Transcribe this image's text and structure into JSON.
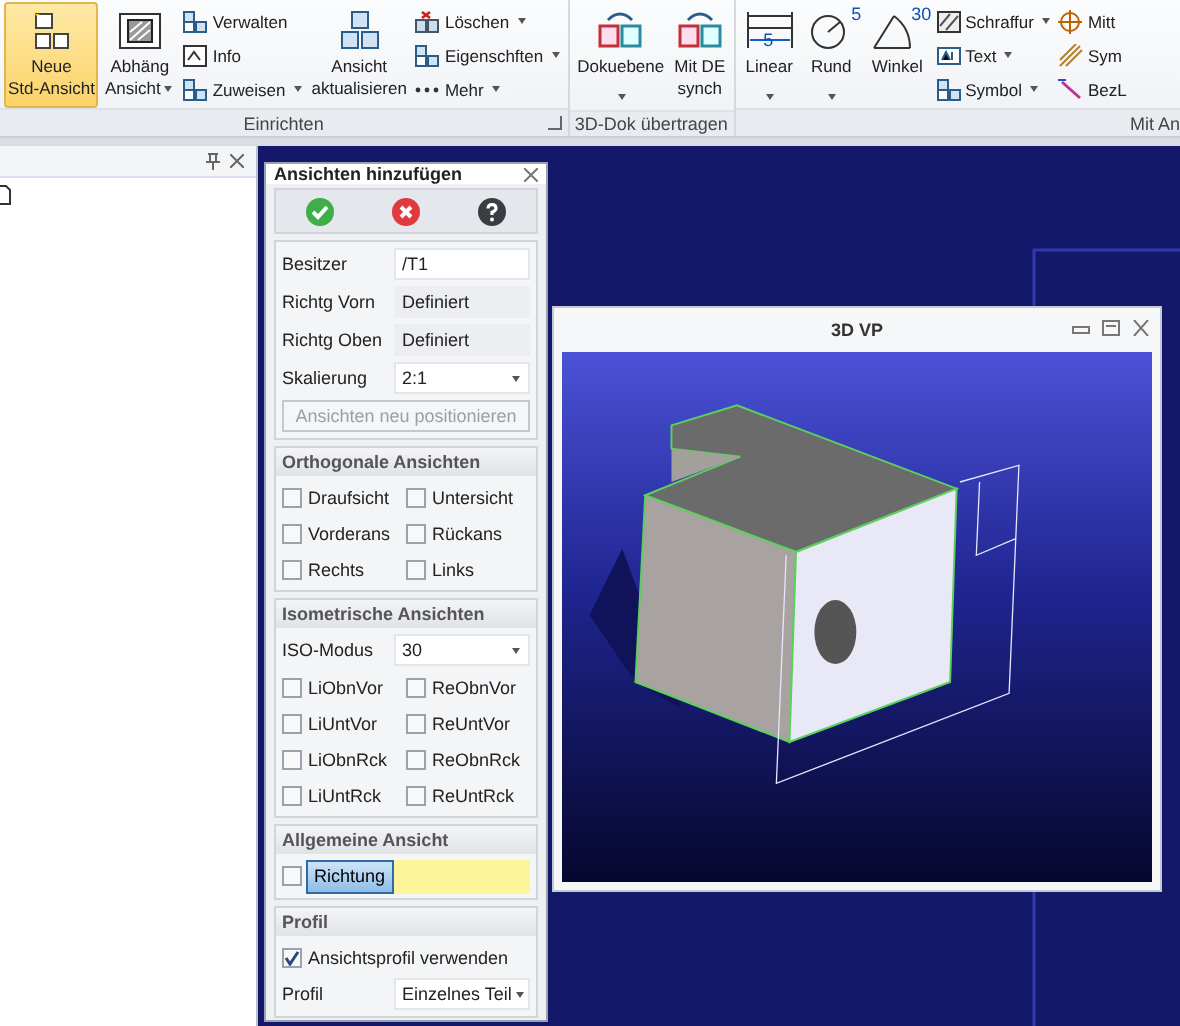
{
  "ribbon": {
    "groups": [
      {
        "label": "Einrichten",
        "launcher": true,
        "items": [
          {
            "kind": "large",
            "lines": [
              "Neue",
              "Std-Ansicht"
            ],
            "selected": true,
            "dropdown": false
          },
          {
            "kind": "large",
            "lines": [
              "Abhäng",
              "Ansicht"
            ],
            "selected": false,
            "dropdown": true
          },
          {
            "kind": "stack",
            "items": [
              {
                "label": "Verwalten",
                "dropdown": false
              },
              {
                "label": "Info",
                "dropdown": false
              },
              {
                "label": "Zuweisen",
                "dropdown": true
              }
            ]
          },
          {
            "kind": "large",
            "lines": [
              "Ansicht",
              "aktualisieren"
            ],
            "selected": false,
            "dropdown": false
          },
          {
            "kind": "stack",
            "items": [
              {
                "label": "Löschen",
                "dropdown": true
              },
              {
                "label": "Eigenschften",
                "dropdown": true
              },
              {
                "label": "Mehr",
                "dropdown": true
              }
            ]
          }
        ]
      },
      {
        "label": "3D-Dok übertragen",
        "launcher": false,
        "items": [
          {
            "kind": "large",
            "lines": [
              "Dokuebene"
            ],
            "selected": false,
            "dropdown": true
          },
          {
            "kind": "large",
            "lines": [
              "Mit DE",
              "synch"
            ],
            "selected": false,
            "dropdown": false
          }
        ]
      },
      {
        "label": "Mit An",
        "launcher": false,
        "items": [
          {
            "kind": "large",
            "lines": [
              "Linear"
            ],
            "icon_label": "5",
            "selected": false,
            "dropdown": true
          },
          {
            "kind": "large",
            "lines": [
              "Rund"
            ],
            "icon_label": "5",
            "selected": false,
            "dropdown": true
          },
          {
            "kind": "large",
            "lines": [
              "Winkel"
            ],
            "icon_label": "30",
            "selected": false,
            "dropdown": false
          },
          {
            "kind": "stack",
            "items": [
              {
                "label": "Schraffur",
                "dropdown": true
              },
              {
                "label": "Text",
                "dropdown": true
              },
              {
                "label": "Symbol",
                "dropdown": true
              }
            ]
          },
          {
            "kind": "stack",
            "items": [
              {
                "label": "Mitt",
                "dropdown": false
              },
              {
                "label": "Sym",
                "dropdown": false
              },
              {
                "label": "BezL",
                "dropdown": false
              }
            ]
          }
        ]
      }
    ]
  },
  "dialog": {
    "title": "Ansichten hinzufügen",
    "sections": [
      {
        "rows": [
          {
            "kind": "input",
            "label": "Besitzer",
            "value": "/T1"
          },
          {
            "kind": "readonly",
            "label": "Richtg Vorn",
            "value": "Definiert"
          },
          {
            "kind": "readonly",
            "label": "Richtg Oben",
            "value": "Definiert"
          },
          {
            "kind": "select",
            "label": "Skalierung",
            "value": "2:1"
          },
          {
            "kind": "button",
            "label": "Ansichten neu positionieren",
            "disabled": true
          }
        ]
      },
      {
        "title": "Orthogonale Ansichten",
        "rows": [
          {
            "kind": "checks",
            "items": [
              {
                "label": "Draufsicht",
                "checked": false
              },
              {
                "label": "Untersicht",
                "checked": false
              }
            ]
          },
          {
            "kind": "checks",
            "items": [
              {
                "label": "Vorderans",
                "checked": false
              },
              {
                "label": "Rückans",
                "checked": false
              }
            ]
          },
          {
            "kind": "checks",
            "items": [
              {
                "label": "Rechts",
                "checked": false
              },
              {
                "label": "Links",
                "checked": false
              }
            ]
          }
        ]
      },
      {
        "title": "Isometrische Ansichten",
        "rows": [
          {
            "kind": "select",
            "label": "ISO-Modus",
            "value": "30"
          },
          {
            "kind": "checks",
            "items": [
              {
                "label": "LiObnVor",
                "checked": false
              },
              {
                "label": "ReObnVor",
                "checked": false
              }
            ]
          },
          {
            "kind": "checks",
            "items": [
              {
                "label": "LiUntVor",
                "checked": false
              },
              {
                "label": "ReUntVor",
                "checked": false
              }
            ]
          },
          {
            "kind": "checks",
            "items": [
              {
                "label": "LiObnRck",
                "checked": false
              },
              {
                "label": "ReObnRck",
                "checked": false
              }
            ]
          },
          {
            "kind": "checks",
            "items": [
              {
                "label": "LiUntRck",
                "checked": false
              },
              {
                "label": "ReUntRck",
                "checked": false
              }
            ]
          }
        ]
      },
      {
        "title": "Allgemeine Ansicht",
        "rows": [
          {
            "kind": "direction",
            "checked": false,
            "label": "Richtung",
            "selected": true
          }
        ]
      },
      {
        "title": "Profil",
        "rows": [
          {
            "kind": "checks",
            "items": [
              {
                "label": "Ansichtsprofil verwenden",
                "checked": true
              }
            ]
          },
          {
            "kind": "select",
            "label": "Profil",
            "value": "Einzelnes Teil"
          }
        ]
      }
    ]
  },
  "viewport": {
    "title": "3D VP"
  }
}
